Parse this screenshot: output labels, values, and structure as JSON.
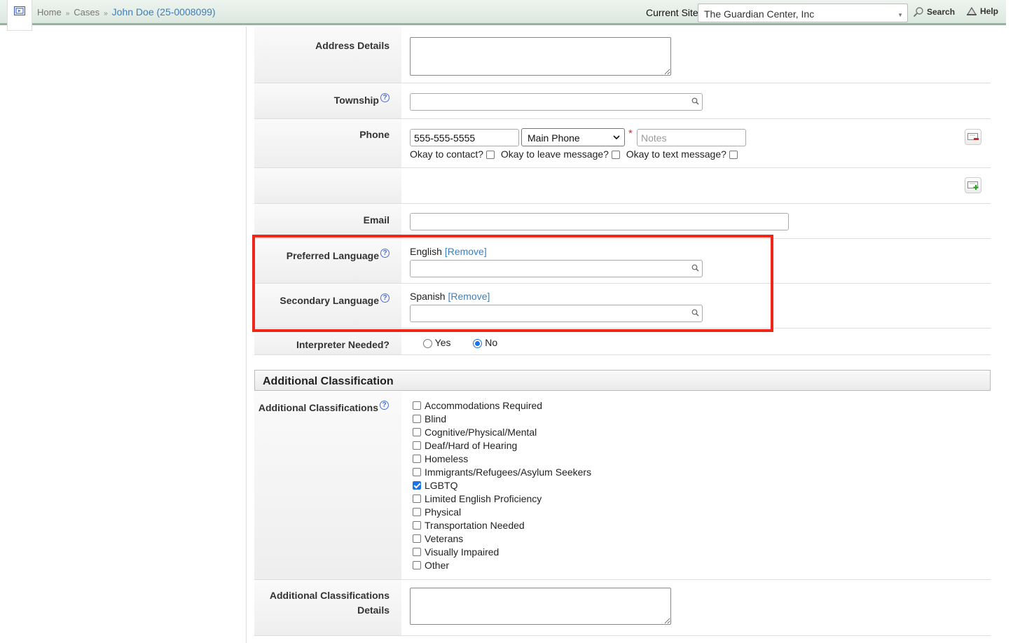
{
  "breadcrumb": {
    "home": "Home",
    "separator": "»",
    "cases": "Cases",
    "current": "John Doe (25-0008099)"
  },
  "topbar": {
    "current_site_label": "Current Site",
    "current_site_value": "The Guardian Center, Inc",
    "search": "Search",
    "help": "Help"
  },
  "form": {
    "address_details_label": "Address Details",
    "township_label": "Township",
    "phone_label": "Phone",
    "phone_value": "555-555-5555",
    "phone_type": "Main Phone",
    "required_mark": "*",
    "phone_notes_placeholder": "Notes",
    "okay_to_contact": "Okay to contact?",
    "okay_to_leave_message": "Okay to leave message?",
    "okay_to_text_message": "Okay to text message?",
    "email_label": "Email",
    "preferred_language_label": "Preferred Language",
    "preferred_language_value": "English",
    "secondary_language_label": "Secondary Language",
    "secondary_language_value": "Spanish",
    "remove_link": "[Remove]",
    "interpreter_label": "Interpreter Needed?",
    "interpreter_yes": "Yes",
    "interpreter_no": "No",
    "interpreter_selected": "No"
  },
  "additional_classification": {
    "section_title": "Additional Classification",
    "label": "Additional Classifications",
    "items": [
      {
        "label": "Accommodations Required",
        "checked": false
      },
      {
        "label": "Blind",
        "checked": false
      },
      {
        "label": "Cognitive/Physical/Mental",
        "checked": false
      },
      {
        "label": "Deaf/Hard of Hearing",
        "checked": false
      },
      {
        "label": "Homeless",
        "checked": false
      },
      {
        "label": "Immigrants/Refugees/Asylum Seekers",
        "checked": false
      },
      {
        "label": "LGBTQ",
        "checked": true
      },
      {
        "label": "Limited English Proficiency",
        "checked": false
      },
      {
        "label": "Physical",
        "checked": false
      },
      {
        "label": "Transportation Needed",
        "checked": false
      },
      {
        "label": "Veterans",
        "checked": false
      },
      {
        "label": "Visually Impaired",
        "checked": false
      },
      {
        "label": "Other",
        "checked": false
      }
    ],
    "details_label_line1": "Additional Classifications",
    "details_label_line2": "Details"
  },
  "colors": {
    "accent": "#3a7fc1",
    "highlight": "#f0261a",
    "checkbox_on": "#1a73e8"
  }
}
